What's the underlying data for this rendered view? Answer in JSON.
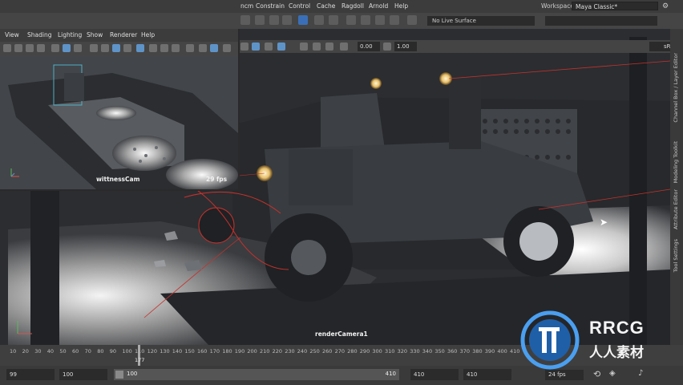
{
  "app": {
    "name": "Maya"
  },
  "main_menu": {
    "items": [
      "ncm",
      "Constrain",
      "Control",
      "Cache",
      "Ragdoll",
      "Arnold",
      "Help"
    ],
    "workspace_label": "Workspace :",
    "workspace_value": "Maya Classic*"
  },
  "status_line": {
    "live_surface": "No Live Surface"
  },
  "witness_panel": {
    "menu": [
      "View",
      "Shading",
      "Lighting",
      "Show",
      "Renderer",
      "Help"
    ],
    "camera_name": "wittnessCam",
    "fps": "29 fps"
  },
  "viewport": {
    "exposure": "0.00",
    "gamma": "1.00",
    "color_space": "sRGB gamma",
    "camera_name": "renderCamera1"
  },
  "right_tabs": [
    "Channel Box / Layer Editor",
    "Modeling Toolkit",
    "Attribute Editor",
    "Tool Settings"
  ],
  "timeline": {
    "ticks": [
      "10",
      "20",
      "30",
      "40",
      "50",
      "60",
      "70",
      "80",
      "90",
      "100",
      "110",
      "120",
      "130",
      "140",
      "150",
      "160",
      "170",
      "180",
      "190",
      "200",
      "210",
      "220",
      "230",
      "240",
      "250",
      "260",
      "270",
      "280",
      "290",
      "300",
      "310",
      "320",
      "330",
      "340",
      "350",
      "360",
      "370",
      "380",
      "390",
      "400",
      "410"
    ],
    "current_frame": "177"
  },
  "range_bar": {
    "start": "99",
    "playback_start": "100",
    "slider_start": "100",
    "slider_end": "410",
    "playback_end": "410",
    "end": "410",
    "fps": "24 fps"
  },
  "watermark": {
    "line1": "RRCG",
    "line2": "人人素材"
  },
  "colors": {
    "accent": "#5ea8ff",
    "selection": "#4fb0c6",
    "curve_red": "#c8312b"
  }
}
